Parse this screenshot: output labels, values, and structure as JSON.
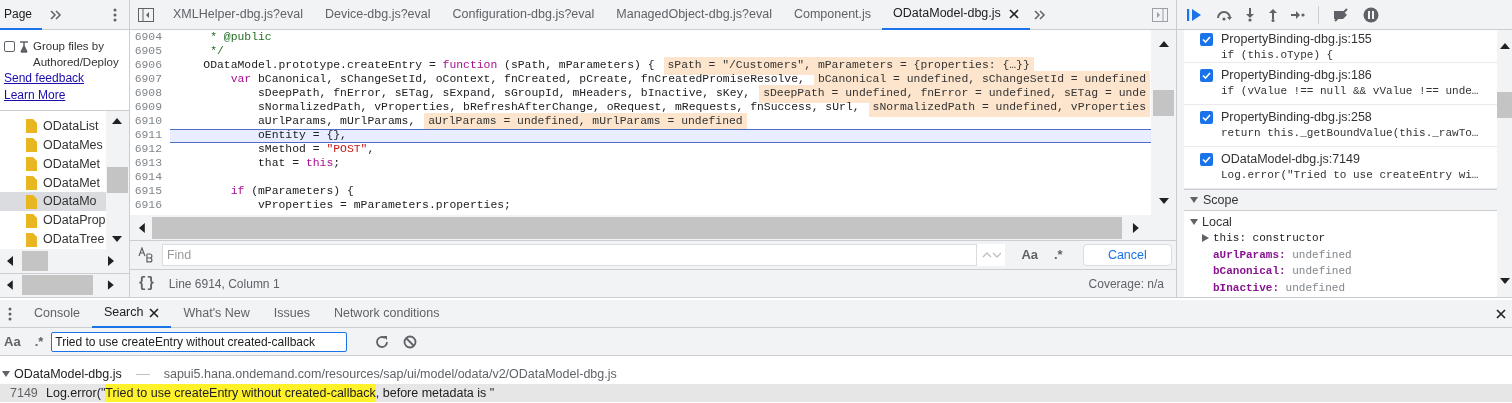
{
  "navigator": {
    "tab": {
      "label": "Page",
      "selected": true
    },
    "group_files": {
      "label": "Group files by Authored/Deploy",
      "checked": false
    },
    "links": [
      "Send feedback",
      "Learn More"
    ],
    "files": [
      {
        "name": "ODataList",
        "selected": false
      },
      {
        "name": "ODataMes",
        "selected": false
      },
      {
        "name": "ODataMet",
        "selected": false
      },
      {
        "name": "ODataMet",
        "selected": false
      },
      {
        "name": "ODataMo",
        "selected": true
      },
      {
        "name": "ODataProp",
        "selected": false
      },
      {
        "name": "ODataTree",
        "selected": false
      }
    ]
  },
  "editor": {
    "tabs": [
      {
        "label": "XMLHelper-dbg.js?eval",
        "selected": false,
        "closable": false
      },
      {
        "label": "Device-dbg.js?eval",
        "selected": false,
        "closable": false
      },
      {
        "label": "Configuration-dbg.js?eval",
        "selected": false,
        "closable": false
      },
      {
        "label": "ManagedObject-dbg.js?eval",
        "selected": false,
        "closable": false
      },
      {
        "label": "Component.js",
        "selected": false,
        "closable": false
      },
      {
        "label": "ODataModel-dbg.js",
        "selected": true,
        "closable": true
      }
    ],
    "lines": [
      {
        "number": "6904",
        "current": false,
        "tokens": [
          {
            "kind": "comment",
            "text": "     * @public"
          }
        ]
      },
      {
        "number": "6905",
        "current": false,
        "tokens": [
          {
            "kind": "comment",
            "text": "     */"
          }
        ]
      },
      {
        "number": "6906",
        "current": false,
        "tokens": [
          {
            "kind": "plain",
            "text": "    ODataModel.prototype.createEntry = "
          },
          {
            "kind": "keyword",
            "text": "function"
          },
          {
            "kind": "plain",
            "text": " (sPath, mParameters) {"
          }
        ],
        "inline": "sPath = \"/Customers\", mParameters = {properties: {…}}"
      },
      {
        "number": "6907",
        "current": false,
        "tokens": [
          {
            "kind": "keyword",
            "text": "        var"
          },
          {
            "kind": "plain",
            "text": " bCanonical, sChangeSetId, oContext, fnCreated, pCreate, fnCreatedPromiseResolve,"
          }
        ],
        "inline": "bCanonical = undefined, sChangeSetId = undefined"
      },
      {
        "number": "6908",
        "current": false,
        "tokens": [
          {
            "kind": "plain",
            "text": "            sDeepPath, fnError, sETag, sExpand, sGroupId, mHeaders, bInactive, sKey,"
          }
        ],
        "inline": "sDeepPath = undefined, fnError = undefined, sETag = unde"
      },
      {
        "number": "6909",
        "current": false,
        "tokens": [
          {
            "kind": "plain",
            "text": "            sNormalizedPath, vProperties, bRefreshAfterChange, oRequest, mRequests, fnSuccess, sUrl,"
          }
        ],
        "inline": "sNormalizedPath = undefined, vProperties"
      },
      {
        "number": "6910",
        "current": false,
        "tokens": [
          {
            "kind": "plain",
            "text": "            aUrlParams, mUrlParams,"
          }
        ],
        "inline": "aUrlParams = undefined, mUrlParams = undefined"
      },
      {
        "number": "6911",
        "current": true,
        "tokens": [
          {
            "kind": "plain",
            "text": "            oEntity = {},"
          }
        ]
      },
      {
        "number": "6912",
        "current": false,
        "tokens": [
          {
            "kind": "plain",
            "text": "            sMethod = "
          },
          {
            "kind": "string",
            "text": "\"POST\""
          },
          {
            "kind": "plain",
            "text": ","
          }
        ]
      },
      {
        "number": "6913",
        "current": false,
        "tokens": [
          {
            "kind": "plain",
            "text": "            that = "
          },
          {
            "kind": "keyword",
            "text": "this"
          },
          {
            "kind": "plain",
            "text": ";"
          }
        ]
      },
      {
        "number": "6914",
        "current": false
      },
      {
        "number": "6915",
        "current": false,
        "tokens": [
          {
            "kind": "keyword",
            "text": "        if"
          },
          {
            "kind": "plain",
            "text": " (mParameters) {"
          }
        ]
      },
      {
        "number": "6916",
        "current": false,
        "tokens": [
          {
            "kind": "plain",
            "text": "            vProperties = mParameters.properties;"
          }
        ]
      }
    ],
    "find": {
      "placeholder": "Find",
      "match_case": "Aa",
      "regex": ".*",
      "cancel": "Cancel"
    },
    "status": {
      "pretty_print": "{}",
      "position": "Line 6914, Column 1",
      "coverage": "Coverage: n/a"
    }
  },
  "debugger": {
    "breakpoints": [
      {
        "location": "PropertyBinding-dbg.js:155",
        "code": "if (this.oType) {",
        "checked": true
      },
      {
        "location": "PropertyBinding-dbg.js:186",
        "code": "if (vValue !== null && vValue !== unde…",
        "checked": true
      },
      {
        "location": "PropertyBinding-dbg.js:258",
        "code": "return this._getBoundValue(this._rawTo…",
        "checked": true
      },
      {
        "location": "ODataModel-dbg.js:7149",
        "code": "Log.error(\"Tried to use createEntry wi…",
        "checked": true
      }
    ],
    "scope": {
      "title": "Scope",
      "expanded": true
    },
    "local": {
      "title": "Local",
      "expanded": true,
      "entries": [
        {
          "kind": "object",
          "name": "this:",
          "value": "constructor"
        },
        {
          "kind": "variable",
          "name": "aUrlParams:",
          "value": "undefined"
        },
        {
          "kind": "variable",
          "name": "bCanonical:",
          "value": "undefined"
        },
        {
          "kind": "variable",
          "name": "bInactive:",
          "value": "undefined"
        }
      ]
    }
  },
  "drawer": {
    "tabs": [
      {
        "label": "Console",
        "selected": false,
        "closable": false
      },
      {
        "label": "Search",
        "selected": true,
        "closable": true
      },
      {
        "label": "What's New",
        "selected": false,
        "closable": false
      },
      {
        "label": "Issues",
        "selected": false,
        "closable": false
      },
      {
        "label": "Network conditions",
        "selected": false,
        "closable": false
      }
    ],
    "search": {
      "match_case": "Aa",
      "regex": ".*",
      "value": "Tried to use createEntry without created-callback"
    },
    "results": [
      {
        "file": "ODataModel-dbg.js",
        "path": "sapui5.hana.ondemand.com/resources/sap/ui/model/odata/v2/ODataModel-dbg.js",
        "expanded": true,
        "matches": [
          {
            "line": "7149",
            "before": "Log.error(\"",
            "match": "Tried to use createEntry without created-callback",
            "after": ", before metadata is \""
          }
        ]
      }
    ]
  }
}
